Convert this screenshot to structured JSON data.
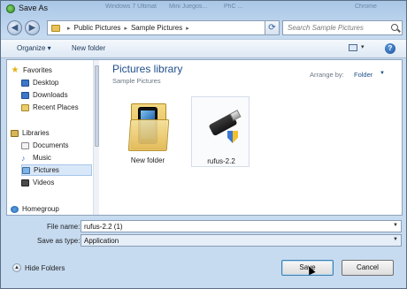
{
  "window": {
    "title": "Save As"
  },
  "background_tabs": [
    "Windows 7 Ultimat",
    "Mini Juegos...",
    "PhC ...",
    "Chrome"
  ],
  "address": {
    "crumbs": [
      "Public Pictures",
      "Sample Pictures"
    ],
    "search_placeholder": "Search Sample Pictures"
  },
  "toolbar": {
    "organize": "Organize ▾",
    "new_folder": "New folder",
    "help": "?"
  },
  "nav": {
    "favorites": {
      "label": "Favorites",
      "items": [
        "Desktop",
        "Downloads",
        "Recent Places"
      ]
    },
    "libraries": {
      "label": "Libraries",
      "items": [
        "Documents",
        "Music",
        "Pictures",
        "Videos"
      ]
    },
    "homegroup": "Homegroup"
  },
  "content": {
    "title": "Pictures library",
    "subtitle": "Sample Pictures",
    "arrange_label": "Arrange by:",
    "arrange_value": "Folder",
    "items": [
      {
        "label": "New folder",
        "icon": "folder-icon"
      },
      {
        "label": "rufus-2.2",
        "icon": "usb-drive-icon"
      }
    ]
  },
  "form": {
    "file_name_label": "File name:",
    "file_name_value": "rufus-2.2 (1)",
    "save_as_type_label": "Save as type:",
    "save_as_type_value": "Application"
  },
  "footer": {
    "hide_folders": "Hide Folders",
    "save": "Save",
    "cancel": "Cancel"
  },
  "colors": {
    "accent": "#1e4f8a",
    "frame": "#c7dbf0"
  }
}
